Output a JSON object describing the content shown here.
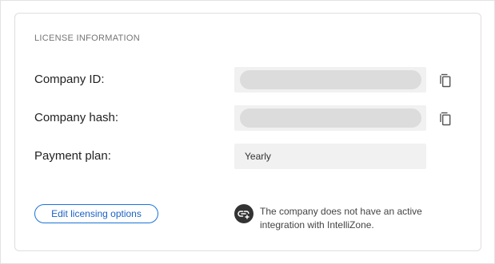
{
  "license": {
    "section_title": "LICENSE INFORMATION",
    "rows": [
      {
        "label": "Company ID:",
        "value": "",
        "masked": true
      },
      {
        "label": "Company hash:",
        "value": "",
        "masked": true
      },
      {
        "label": "Payment plan:",
        "value": "Yearly",
        "masked": false
      }
    ],
    "edit_button_label": "Edit licensing options",
    "integration_notice": "The company does not have an active integration with IntelliZone.",
    "icons": {
      "copy": "copy-icon",
      "integration": "link-add-icon"
    },
    "colors": {
      "accent": "#1a73d9",
      "field_bg": "#f1f1f1",
      "mask": "#dcdcdc",
      "icon_bg": "#333333"
    }
  }
}
